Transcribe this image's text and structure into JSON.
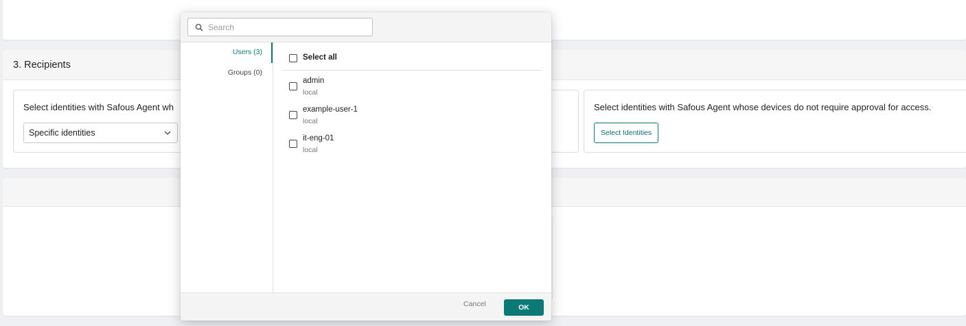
{
  "colors": {
    "accent": "#0b7a77",
    "background": "#eef0f4"
  },
  "recipients": {
    "title": "3. Recipients",
    "left_panel": {
      "description": "Select identities with Safous Agent wh",
      "select_value": "Specific identities"
    },
    "right_panel": {
      "description": "Select identities with Safous Agent whose devices do not require approval for access.",
      "button_label": "Select Identities"
    }
  },
  "modal": {
    "search": {
      "placeholder": "Search",
      "value": ""
    },
    "nav": [
      {
        "label": "Users (3)",
        "active": true
      },
      {
        "label": "Groups (0)",
        "active": false
      }
    ],
    "select_all_label": "Select all",
    "users": [
      {
        "name": "admin",
        "source": "local"
      },
      {
        "name": "example-user-1",
        "source": "local"
      },
      {
        "name": "it-eng-01",
        "source": "local"
      }
    ],
    "footer": {
      "cancel_label": "Cancel",
      "ok_label": "OK"
    }
  }
}
